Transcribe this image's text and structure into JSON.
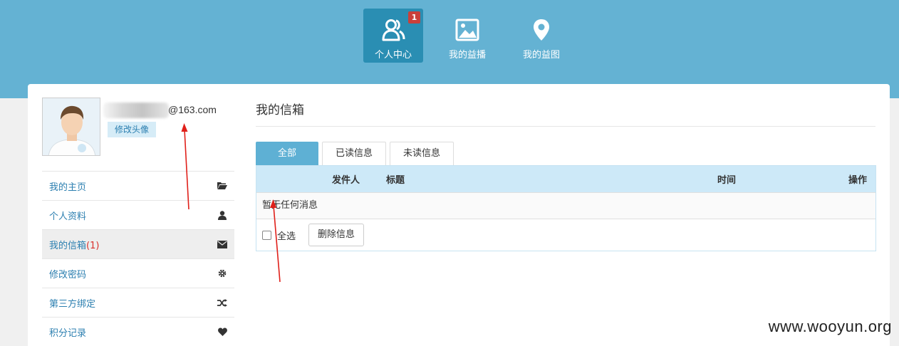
{
  "top_nav": [
    {
      "label": "个人中心",
      "icon": "users-icon",
      "badge": "1",
      "active": true
    },
    {
      "label": "我的益播",
      "icon": "image-icon"
    },
    {
      "label": "我的益图",
      "icon": "map-pin-icon"
    }
  ],
  "profile": {
    "email_suffix": "@163.com",
    "change_avatar_label": "修改头像"
  },
  "side_menu": [
    {
      "label": "我的主页",
      "icon": "folder-open-icon"
    },
    {
      "label": "个人资料",
      "icon": "user-icon"
    },
    {
      "label": "我的信箱",
      "count": "(1)",
      "icon": "envelope-icon",
      "active": true
    },
    {
      "label": "修改密码",
      "icon": "gear-icon"
    },
    {
      "label": "第三方绑定",
      "icon": "shuffle-icon"
    },
    {
      "label": "积分记录",
      "icon": "heart-icon"
    }
  ],
  "inbox": {
    "title": "我的信箱",
    "tabs": [
      {
        "label": "全部",
        "active": true
      },
      {
        "label": "已读信息"
      },
      {
        "label": "未读信息"
      }
    ],
    "columns": {
      "sender": "发件人",
      "subject": "标题",
      "time": "时间",
      "operation": "操作"
    },
    "empty_text": "暂无任何消息",
    "select_all_label": "全选",
    "delete_label": "删除信息"
  },
  "watermark": "www.wooyun.org",
  "colors": {
    "header_bg": "#64b2d3",
    "active_nav": "#2a8eb3",
    "badge": "#c9403a",
    "link": "#2c7fb0",
    "table_header": "#cde9f8",
    "annotation": "#e0201a"
  }
}
